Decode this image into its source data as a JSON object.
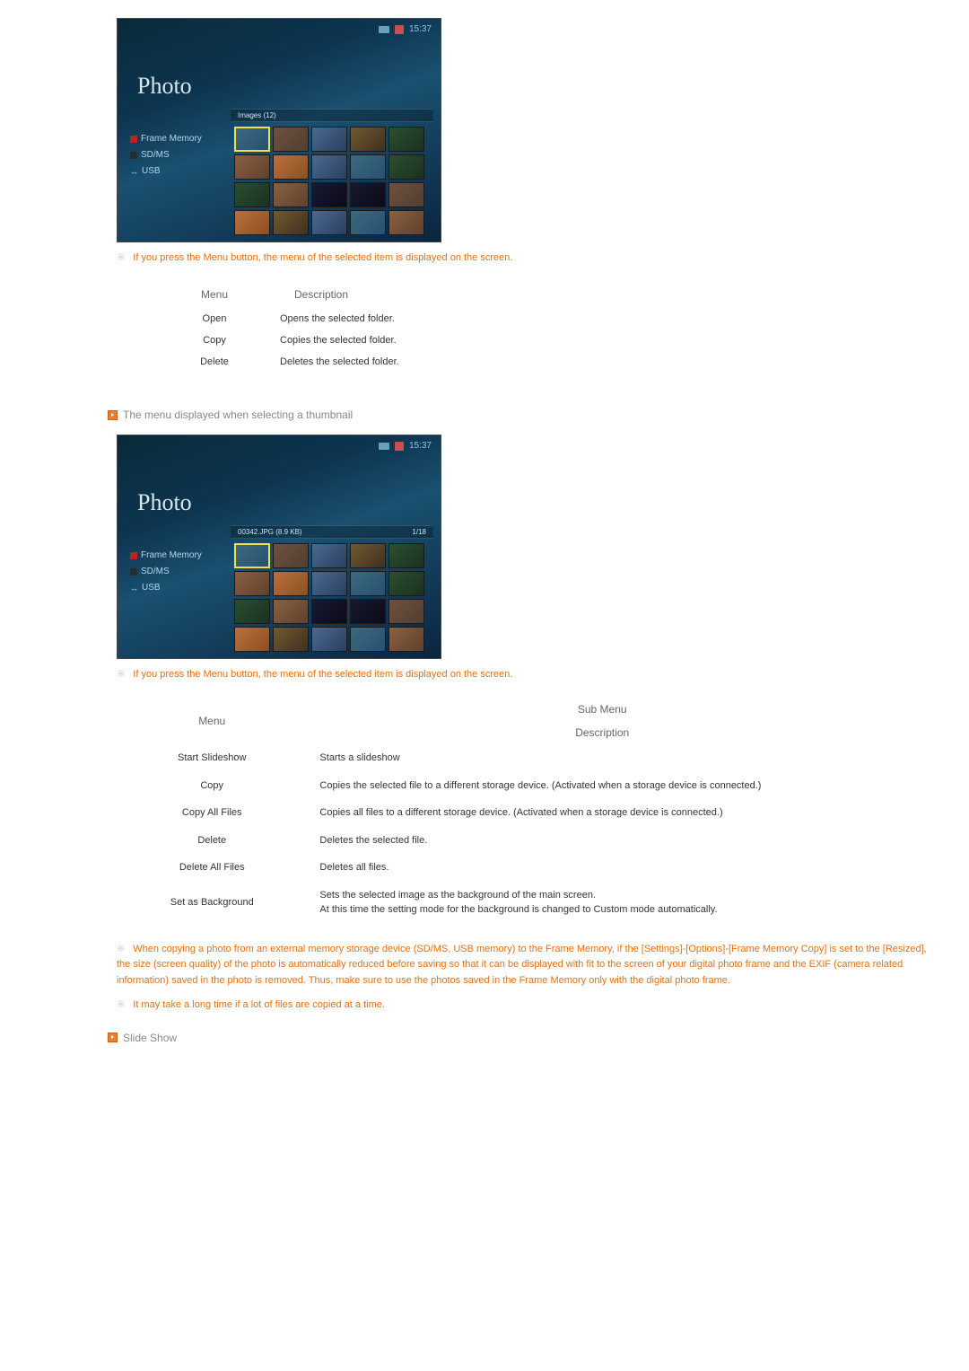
{
  "screenshot1": {
    "title": "Photo",
    "time": "15:37",
    "headerLabel": "Images (12)",
    "headerRight": "",
    "sidebar": {
      "frameMemory": "Frame Memory",
      "sdms": "SD/MS",
      "usb": "USB"
    }
  },
  "note1": "If you press the Menu button, the menu of the selected item is displayed on the screen.",
  "table1": {
    "headerMenu": "Menu",
    "headerDesc": "Description",
    "rows": [
      {
        "menu": "Open",
        "desc": "Opens the selected folder."
      },
      {
        "menu": "Copy",
        "desc": "Copies the selected folder."
      },
      {
        "menu": "Delete",
        "desc": "Deletes the selected folder."
      }
    ]
  },
  "sectionHeading2": "The menu displayed when selecting a thumbnail",
  "screenshot2": {
    "title": "Photo",
    "time": "15:37",
    "headerLabel": "00342.JPG (8.9 KB)",
    "headerRight": "1/18",
    "sidebar": {
      "frameMemory": "Frame Memory",
      "sdms": "SD/MS",
      "usb": "USB"
    }
  },
  "note2": "If you press the Menu button, the menu of the selected item is displayed on the screen.",
  "table2": {
    "headerMenu": "Menu",
    "headerSubMenu": "Sub Menu",
    "headerDesc": "Description",
    "rows": [
      {
        "menu": "Start Slideshow",
        "desc": "Starts a slideshow"
      },
      {
        "menu": "Copy",
        "desc": "Copies the selected file to a different storage device. (Activated when a storage device is connected.)"
      },
      {
        "menu": "Copy All Files",
        "desc": "Copies all files to a different storage device. (Activated when a storage device is connected.)"
      },
      {
        "menu": "Delete",
        "desc": "Deletes the selected file."
      },
      {
        "menu": "Delete All Files",
        "desc": "Deletes all files."
      },
      {
        "menu": "Set as Background",
        "desc": "Sets the selected image as the background of the main screen.\nAt this time the setting mode for the background is changed to Custom mode automatically."
      }
    ]
  },
  "note3": "When copying a photo from an external memory storage device (SD/MS, USB memory) to the Frame Memory, if the [Settings]-[Options]-[Frame Memory Copy] is set to the [Resized], the size (screen quality) of the photo is automatically reduced before saving so that it can be displayed with fit to the screen of your digital photo frame and the EXIF (camera related information) saved in the photo is removed. Thus, make sure to use the photos saved in the Frame Memory only with the digital photo frame.",
  "note4": "It may take a long time if a lot of files are copied at a time.",
  "sectionHeading3": "Slide Show"
}
